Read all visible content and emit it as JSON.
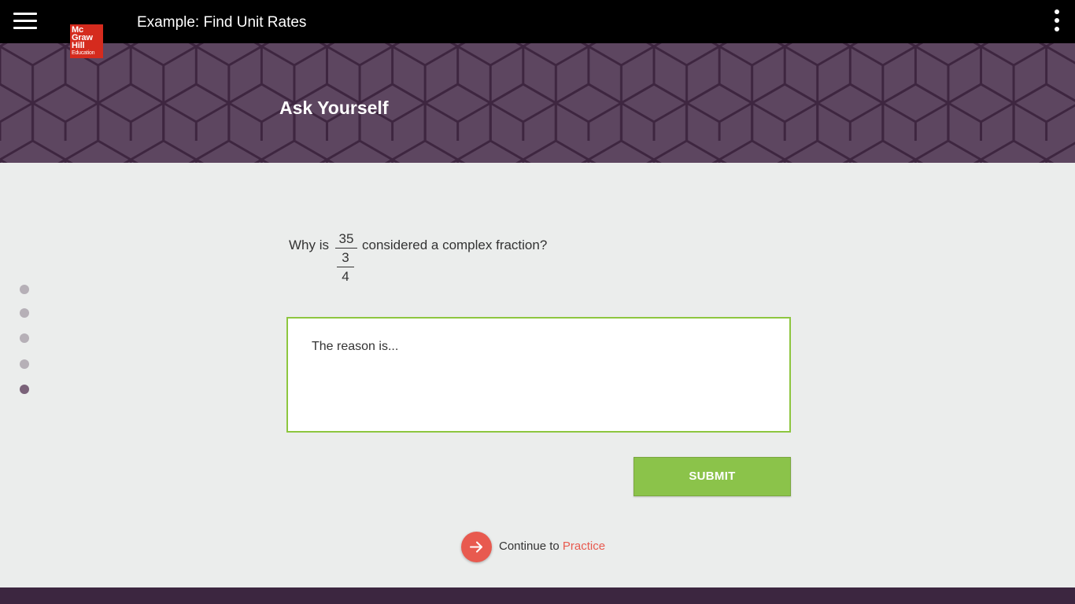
{
  "header": {
    "title": "Example: Find Unit Rates",
    "logo": {
      "lines": [
        "Mc",
        "Graw",
        "Hill"
      ],
      "subline": "Education"
    }
  },
  "banner": {
    "title": "Ask Yourself"
  },
  "progress": {
    "total": 5,
    "current": 5
  },
  "question": {
    "prefix": "Why is",
    "fraction": {
      "numerator": "35",
      "inner_numerator": "3",
      "inner_denominator": "4"
    },
    "suffix": "considered a complex fraction?"
  },
  "answer": {
    "placeholder": "The reason is...",
    "value": ""
  },
  "submit": {
    "label": "SUBMIT"
  },
  "continue": {
    "prefix": "Continue to",
    "link": "Practice"
  },
  "colors": {
    "banner": "#5d4660",
    "accent_green": "#8bc34a",
    "accent_red": "#e85a4f",
    "footer": "#3c2640"
  }
}
